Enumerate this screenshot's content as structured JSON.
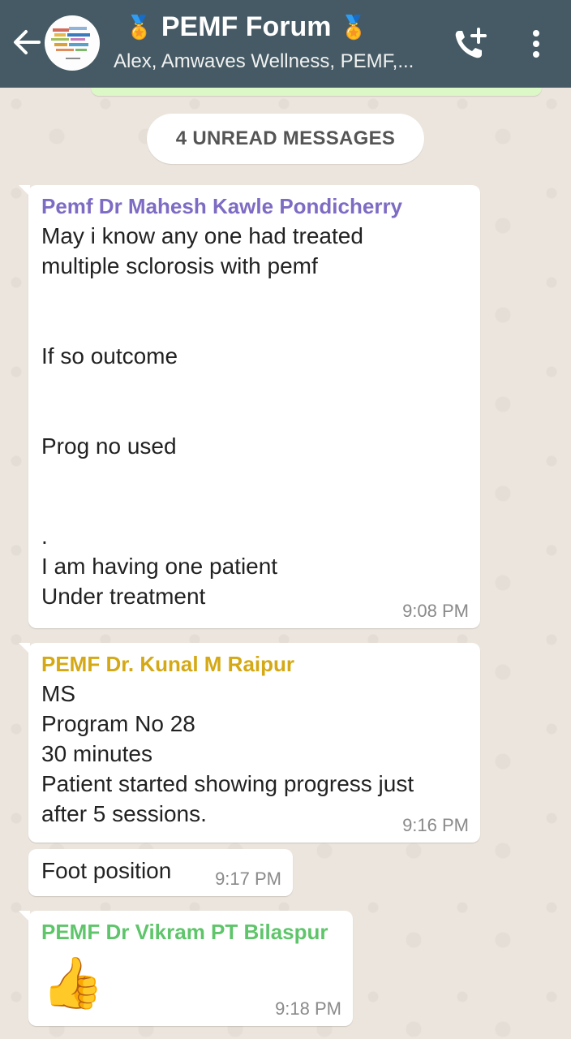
{
  "header": {
    "title": "PEMF Forum",
    "title_emoji_left": "🏅",
    "title_emoji_right": "🏅",
    "subtitle": "Alex, Amwaves Wellness, PEMF,...",
    "avatar_icon": "group-avatar-icon",
    "bg_color": "#455a64"
  },
  "unread_banner": "4 UNREAD MESSAGES",
  "messages": [
    {
      "sender": "Pemf Dr Mahesh Kawle Pondicherry",
      "sender_color": "#7e6bc4",
      "text": "May i know any one had treated\nmultiple sclorosis with pemf\n\n\nIf so outcome\n\n\nProg no used\n\n\n.\nI am having one patient\nUnder treatment",
      "time": "9:08 PM"
    },
    {
      "sender": "PEMF Dr. Kunal M Raipur",
      "sender_color": "#d4a915",
      "text": "MS\nProgram No 28\n30 minutes\nPatient started showing progress just\nafter 5 sessions.",
      "time": "9:16 PM"
    },
    {
      "text": "Foot position",
      "time": "9:17 PM"
    },
    {
      "sender": "PEMF Dr Vikram PT Bilaspur",
      "sender_color": "#5ec56a",
      "emoji": "👍",
      "time": "9:18 PM"
    }
  ]
}
